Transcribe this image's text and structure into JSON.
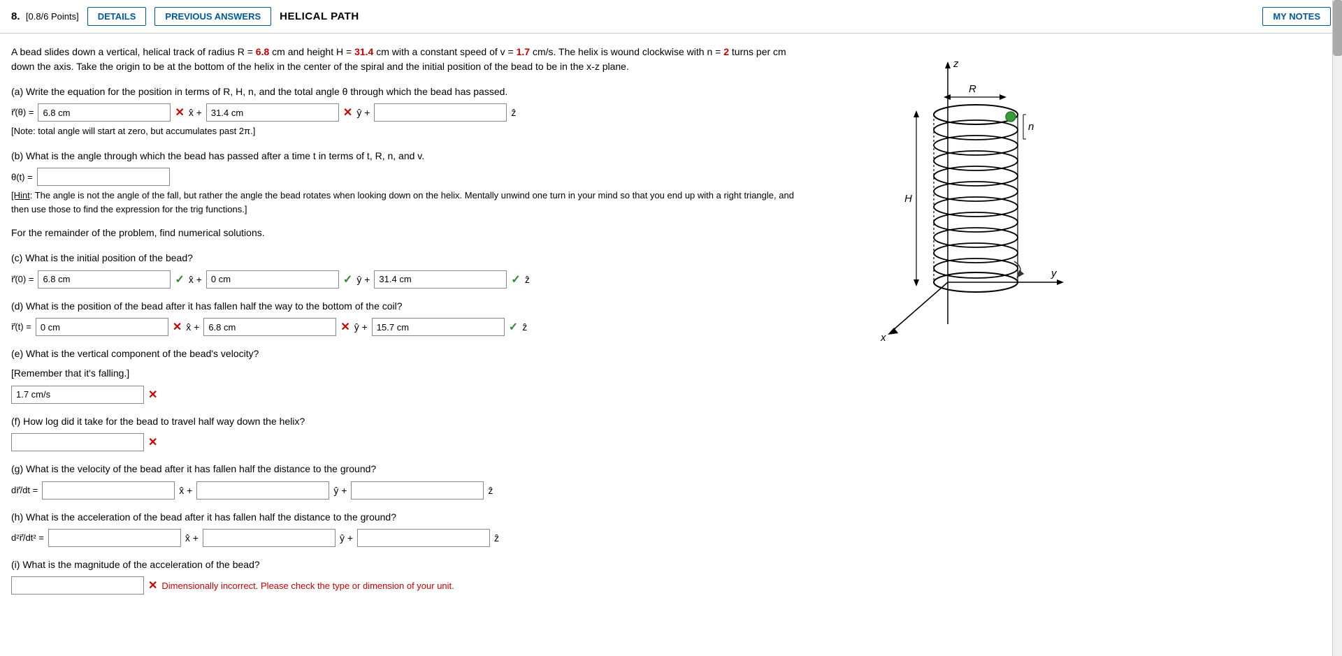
{
  "header": {
    "problem_num": "8.",
    "points": "[0.8/6 Points]",
    "details_label": "DETAILS",
    "prev_answers_label": "PREVIOUS ANSWERS",
    "title": "HELICAL PATH",
    "my_notes_label": "MY NOTES"
  },
  "problem": {
    "intro": "A bead slides down a vertical, helical track of radius R = 6.8 cm and height H = 31.4 cm with a constant speed of v = 1.7 cm/s. The helix is wound clockwise with n = 2 turns per cm down the axis. Take the origin to be at the bottom of the helix in the center of the spiral and the initial position of the bead to be in the x-z plane.",
    "part_a": {
      "label": "(a) Write the equation for the position in terms of R, H, n, and the total angle θ through which the bead has passed.",
      "vec_label": "r⃗(θ) =",
      "input1_value": "6.8 cm",
      "plus1": "x̂ +",
      "input2_value": "31.4 cm",
      "plus2": "ŷ +",
      "input3_value": "",
      "hat3": "ẑ",
      "status1": "x",
      "status2": "x",
      "note": "[Note: total angle will start at zero, but accumulates past 2π.]"
    },
    "part_b": {
      "label": "(b) What is the angle through which the bead has passed after a time t in terms of t, R, n, and v.",
      "theta_label": "θ(t) =",
      "input_value": "",
      "hint": "[Hint: The angle is not the angle of the fall, but rather the angle the bead rotates when looking down on the helix. Mentally unwind one turn in your mind so that you end up with a right triangle, and then use those to find the expression for the trig functions.]"
    },
    "remainder": "For the remainder of the problem, find numerical solutions.",
    "part_c": {
      "label": "(c) What is the initial position of the bead?",
      "vec_label": "r⃗(0) =",
      "input1_value": "6.8 cm",
      "status1": "✓",
      "plus1": "x̂ +",
      "input2_value": "0 cm",
      "status2": "✓",
      "plus2": "ŷ +",
      "input3_value": "31.4 cm",
      "status3": "✓",
      "hat3": "ẑ"
    },
    "part_d": {
      "label": "(d) What is the position of the bead after it has fallen half the way to the bottom of the coil?",
      "vec_label": "r⃗(t) =",
      "input1_value": "0 cm",
      "status1": "x",
      "plus1": "x̂ +",
      "input2_value": "6.8 cm",
      "status2": "x",
      "plus2": "ŷ +",
      "input3_value": "15.7 cm",
      "status3": "✓",
      "hat3": "ẑ"
    },
    "part_e": {
      "label": "(e) What is the vertical component of the bead's velocity?",
      "sublabel": "[Remember that it's falling.]",
      "input_value": "1.7 cm/s",
      "status": "x"
    },
    "part_f": {
      "label": "(f) How log did it take for the bead to travel half way down the helix?",
      "input_value": "",
      "status": "x"
    },
    "part_g": {
      "label": "(g) What is the velocity of the bead after it has fallen half the distance to the ground?",
      "vec_label": "dr⃗/dt =",
      "input1_value": "",
      "plus1": "x̂ +",
      "input2_value": "",
      "plus2": "ŷ +",
      "input3_value": "",
      "hat3": "ẑ"
    },
    "part_h": {
      "label": "(h) What is the acceleration of the bead after it has fallen half the distance to the ground?",
      "vec_label": "d²r⃗/dt² =",
      "input1_value": "",
      "plus1": "x̂ +",
      "input2_value": "",
      "plus2": "ŷ +",
      "input3_value": "",
      "hat3": "ẑ"
    },
    "part_i": {
      "label": "(i) What is the magnitude of the acceleration of the bead?",
      "input_value": "",
      "status": "x",
      "error_msg": "Dimensionally incorrect. Please check the type or dimension of your unit."
    }
  }
}
